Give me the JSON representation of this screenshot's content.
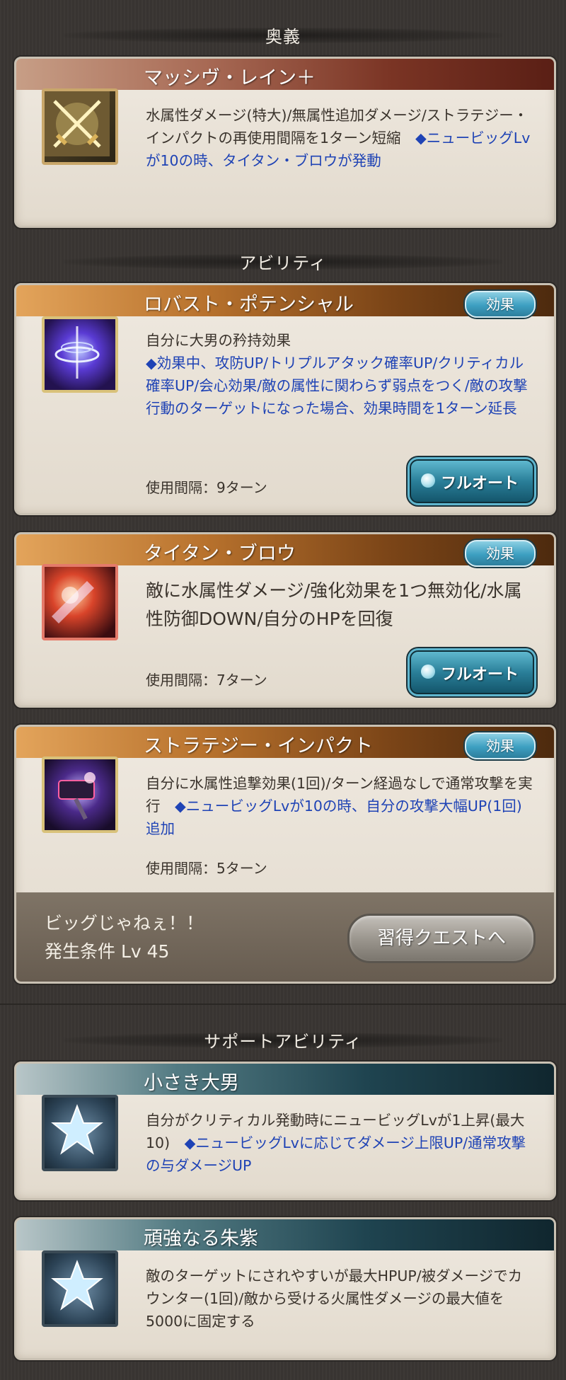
{
  "sections": {
    "ougi": "奥義",
    "ability": "アビリティ",
    "support": "サポートアビリティ"
  },
  "ougi": {
    "name": "マッシヴ・レイン＋",
    "desc_plain": "水属性ダメージ(特大)/無属性追加ダメージ/ストラテジー・インパクトの再使用間隔を1ターン短縮　",
    "desc_highlight": "◆ニュービッグLvが10の時、タイタン・ブロウが発動"
  },
  "abilities": [
    {
      "name": "ロバスト・ポテンシャル",
      "effect_label": "効果",
      "desc_plain": "自分に大男の矜持効果",
      "desc_highlight": "◆効果中、攻防UP/トリプルアタック確率UP/クリティカル確率UP/会心効果/敵の属性に関わらず弱点をつく/敵の攻撃行動のターゲットになった場合、効果時間を1ターン延長",
      "cooldown": "使用間隔：9ターン",
      "fullauto_label": "フルオート"
    },
    {
      "name": "タイタン・ブロウ",
      "effect_label": "効果",
      "desc_plain": "敵に水属性ダメージ/強化効果を1つ無効化/水属性防御DOWN/自分のHPを回復",
      "cooldown": "使用間隔：7ターン",
      "fullauto_label": "フルオート"
    },
    {
      "name": "ストラテジー・インパクト",
      "effect_label": "効果",
      "desc_plain": "自分に水属性追撃効果(1回)/ターン経過なしで通常攻撃を実行　",
      "desc_highlight": "◆ニュービッグLvが10の時、自分の攻撃大幅UP(1回)追加",
      "cooldown": "使用間隔：5ターン",
      "locked_name": "ビッグじゃねぇ！！",
      "locked_condition": "発生条件 Lv 45",
      "quest_button": "習得クエストへ"
    }
  ],
  "supports": [
    {
      "name": "小さき大男",
      "desc_plain": "自分がクリティカル発動時にニュービッグLvが1上昇(最大10)　",
      "desc_highlight": "◆ニュービッグLvに応じてダメージ上限UP/通常攻撃の与ダメージUP"
    },
    {
      "name": "頑強なる朱紫",
      "desc_plain": "敵のターゲットにされやすいが最大HPUP/被ダメージでカウンター(1回)/敵から受ける火属性ダメージの最大値を5000に固定する"
    }
  ],
  "colors": {
    "highlight_text": "#1f43b5",
    "body_text": "#3a332c"
  },
  "icons": [
    "crossed-swords-icon",
    "purple-swirl-icon",
    "red-impact-icon",
    "hammer-strike-icon",
    "star-icon",
    "star-icon"
  ]
}
